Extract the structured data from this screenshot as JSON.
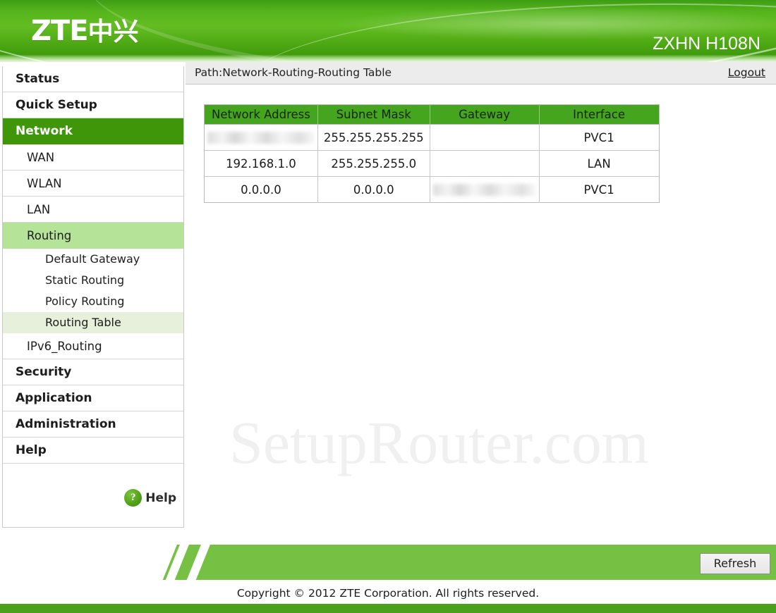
{
  "header": {
    "brand_latin": "ZTE",
    "brand_cjk": "中兴",
    "model": "ZXHN H108N",
    "brand_green": "#3f9c0c"
  },
  "sidebar": {
    "items": [
      {
        "label": "Status",
        "level": 1,
        "state": "normal"
      },
      {
        "label": "Quick Setup",
        "level": 1,
        "state": "normal"
      },
      {
        "label": "Network",
        "level": 1,
        "state": "active"
      },
      {
        "label": "WAN",
        "level": 2,
        "state": "normal"
      },
      {
        "label": "WLAN",
        "level": 2,
        "state": "normal"
      },
      {
        "label": "LAN",
        "level": 2,
        "state": "normal"
      },
      {
        "label": "Routing",
        "level": 2,
        "state": "open"
      },
      {
        "label": "Default Gateway",
        "level": 3,
        "state": "normal"
      },
      {
        "label": "Static Routing",
        "level": 3,
        "state": "normal"
      },
      {
        "label": "Policy Routing",
        "level": 3,
        "state": "normal"
      },
      {
        "label": "Routing Table",
        "level": 3,
        "state": "active"
      },
      {
        "label": "IPv6_Routing",
        "level": 2,
        "state": "normal"
      },
      {
        "label": "Security",
        "level": 1,
        "state": "normal"
      },
      {
        "label": "Application",
        "level": 1,
        "state": "normal"
      },
      {
        "label": "Administration",
        "level": 1,
        "state": "normal"
      },
      {
        "label": "Help",
        "level": 1,
        "state": "normal"
      }
    ],
    "help_button": {
      "icon": "question-mark-circle-icon",
      "icon_glyph": "?",
      "label": "Help"
    },
    "active_color": "#3e9608",
    "open_color": "#b5e398",
    "subactive_color": "#e7f0db"
  },
  "pathbar": {
    "path": "Path:Network-Routing-Routing Table",
    "logout_label": "Logout"
  },
  "watermark": {
    "text": "SetupRouter.com"
  },
  "routing_table": {
    "header_color": "#45a51f",
    "columns": [
      "Network Address",
      "Subnet Mask",
      "Gateway",
      "Interface"
    ],
    "rows": [
      {
        "network_address": "",
        "network_address_redacted": true,
        "subnet_mask": "255.255.255.255",
        "subnet_mask_redacted": false,
        "gateway": "",
        "gateway_redacted": false,
        "interface": "PVC1",
        "interface_redacted": false
      },
      {
        "network_address": "192.168.1.0",
        "network_address_redacted": false,
        "subnet_mask": "255.255.255.0",
        "subnet_mask_redacted": false,
        "gateway": "",
        "gateway_redacted": false,
        "interface": "LAN",
        "interface_redacted": false
      },
      {
        "network_address": "0.0.0.0",
        "network_address_redacted": false,
        "subnet_mask": "0.0.0.0",
        "subnet_mask_redacted": false,
        "gateway": "",
        "gateway_redacted": true,
        "interface": "PVC1",
        "interface_redacted": false
      }
    ]
  },
  "footer": {
    "refresh_label": "Refresh",
    "copyright": "Copyright © 2012 ZTE Corporation. All rights reserved.",
    "band_color": "#76c043",
    "bottom_bar_color": "#4ba01e"
  }
}
